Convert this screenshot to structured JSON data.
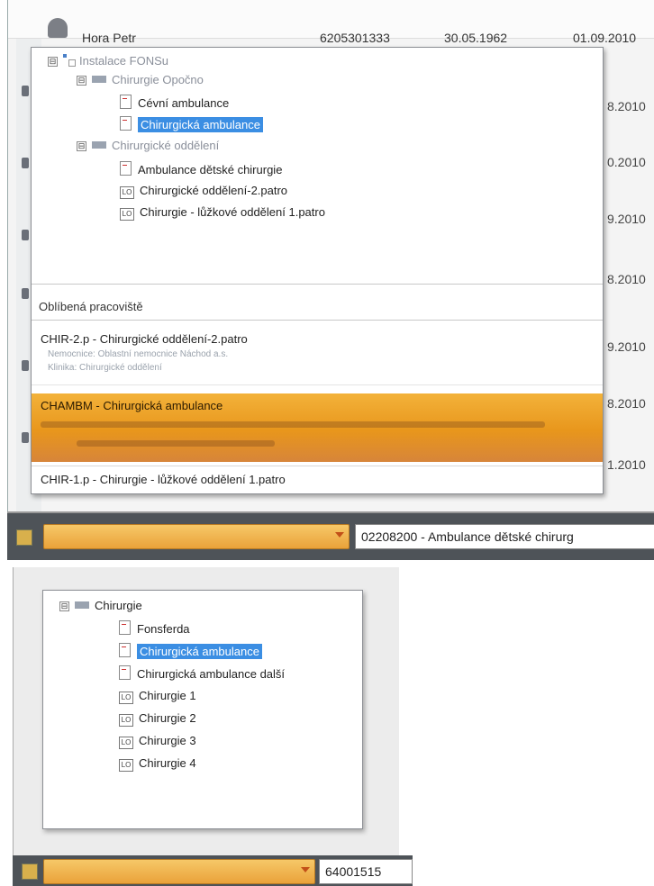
{
  "top": {
    "background_row": {
      "name": "Hora Petr",
      "id": "6205301333",
      "birth_date": "30.05.1962",
      "date": "01.09.2010"
    },
    "background_dates": [
      "8.2010",
      "0.2010",
      "9.2010",
      "8.2010",
      "9.2010",
      "8.2010",
      "1.2010"
    ],
    "tree": {
      "root_label": "Instalace FONSu",
      "group1_label": "Chirurgie Opočno",
      "group1_children": [
        "Cévní ambulance",
        "Chirurgická ambulance"
      ],
      "group2_label": "Chirurgické oddělení",
      "group2_children": [
        "Ambulance dětské chirurgie",
        "Chirurgické oddělení-2.patro",
        "Chirurgie - lůžkové oddělení 1.patro"
      ],
      "icon_lo": "LO",
      "expander": "⊟"
    },
    "favorites": {
      "header": "Oblíbená pracoviště",
      "item1": {
        "title": "CHIR-2.p - Chirurgické oddělení-2.patro",
        "line1": "Nemocnice: Oblastní nemocnice Náchod a.s.",
        "line2": "Klinika: Chirurgické oddělení"
      },
      "item2": {
        "title": "CHAMBM - Chirurgická ambulance"
      },
      "item3": {
        "title": "CHIR-1.p - Chirurgie - lůžkové oddělení 1.patro"
      }
    },
    "status_field": "02208200 - Ambulance dětské chirurg"
  },
  "bottom": {
    "tree": {
      "root_label": "Chirurgie",
      "children": [
        "Fonsferda",
        "Chirurgická ambulance",
        "Chirurgická ambulance další",
        "Chirurgie 1",
        "Chirurgie 2",
        "Chirurgie 3",
        "Chirurgie 4"
      ],
      "icon_lo": "LO",
      "expander": "⊟"
    },
    "status_field": "64001515"
  },
  "colors": {
    "selection": "#3b8ee3",
    "favorite_active": "#e8961c",
    "taskbar": "#4e5358"
  }
}
